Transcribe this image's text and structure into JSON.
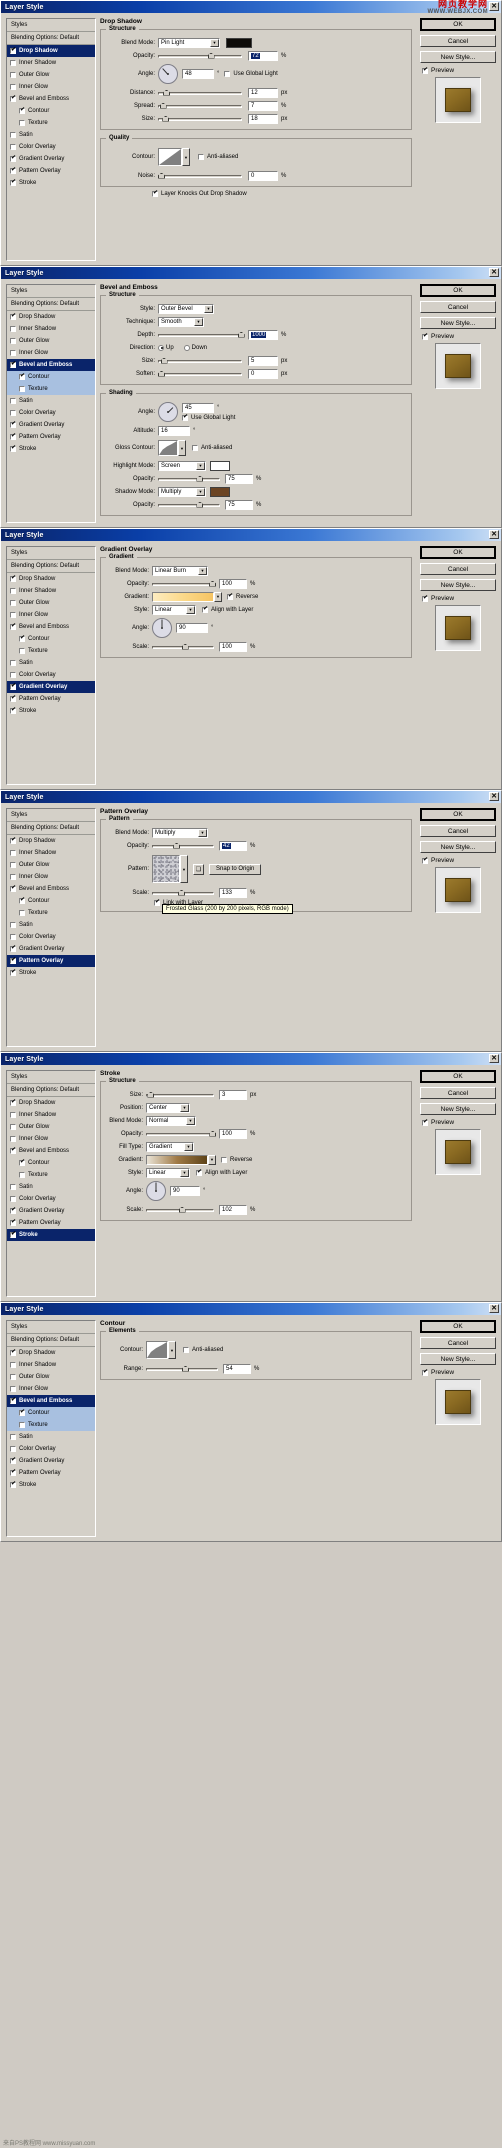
{
  "watermark": {
    "line1": "网页教学网",
    "line2": "WWW.WEBJX.COM"
  },
  "footer_credit": "来自PS教程网 www.missyuan.com",
  "common": {
    "title": "Layer Style",
    "close_label": "✕",
    "styles_header": "Styles",
    "blending_options": "Blending Options: Default",
    "buttons": {
      "ok": "OK",
      "cancel": "Cancel",
      "new_style": "New Style...",
      "preview": "Preview"
    },
    "style_items": [
      {
        "label": "Drop Shadow",
        "checked": true
      },
      {
        "label": "Inner Shadow",
        "checked": false
      },
      {
        "label": "Outer Glow",
        "checked": false
      },
      {
        "label": "Inner Glow",
        "checked": false
      },
      {
        "label": "Bevel and Emboss",
        "checked": true
      },
      {
        "label": "Contour",
        "checked": true,
        "sub": true
      },
      {
        "label": "Texture",
        "checked": false,
        "sub": true
      },
      {
        "label": "Satin",
        "checked": false
      },
      {
        "label": "Color Overlay",
        "checked": false
      },
      {
        "label": "Gradient Overlay",
        "checked": true
      },
      {
        "label": "Pattern Overlay",
        "checked": true
      },
      {
        "label": "Stroke",
        "checked": true
      }
    ],
    "labels": {
      "blend_mode": "Blend Mode:",
      "opacity": "Opacity:",
      "angle": "Angle:",
      "distance": "Distance:",
      "spread": "Spread:",
      "size": "Size:",
      "contour": "Contour:",
      "noise": "Noise:",
      "anti_aliased": "Anti-aliased",
      "use_global_light": "Use Global Light",
      "layer_knocks_out": "Layer Knocks Out Drop Shadow",
      "style": "Style:",
      "technique": "Technique:",
      "depth": "Depth:",
      "direction": "Direction:",
      "soften": "Soften:",
      "altitude": "Altitude:",
      "gloss_contour": "Gloss Contour:",
      "highlight_mode": "Highlight Mode:",
      "shadow_mode": "Shadow Mode:",
      "gradient": "Gradient:",
      "reverse": "Reverse",
      "align_with_layer": "Align with Layer",
      "scale": "Scale:",
      "pattern": "Pattern:",
      "snap_to_origin": "Snap to Origin",
      "link_with_layer": "Link with Layer",
      "position": "Position:",
      "fill_type": "Fill Type:",
      "range": "Range:",
      "elements": "Elements",
      "up": "Up",
      "down": "Down",
      "pct": "%",
      "px": "px",
      "deg": "°"
    }
  },
  "dialogs": [
    {
      "id": "drop-shadow",
      "selected": "Drop Shadow",
      "panel_title": "Drop Shadow",
      "group1": "Structure",
      "group2": "Quality",
      "blend_mode": "Pin Light",
      "blend_color": "#0d0b08",
      "opacity": "72",
      "angle": "48",
      "use_global_light": false,
      "distance": "12",
      "spread": "7",
      "size": "18",
      "anti_aliased": false,
      "noise": "0",
      "knocks_out": true
    },
    {
      "id": "bevel-emboss",
      "selected": "Bevel and Emboss",
      "panel_title": "Bevel and Emboss",
      "group1": "Structure",
      "group2": "Shading",
      "style": "Outer Bevel",
      "technique": "Smooth",
      "depth": "1000",
      "direction": "Up",
      "size": "5",
      "soften": "0",
      "angle": "45",
      "use_global_light": true,
      "altitude": "16",
      "anti_aliased": false,
      "highlight_mode": "Screen",
      "highlight_color": "#ffffff",
      "highlight_opacity": "75",
      "shadow_mode": "Multiply",
      "shadow_color": "#6b4423",
      "shadow_opacity": "75"
    },
    {
      "id": "gradient-overlay",
      "selected": "Gradient Overlay",
      "panel_title": "Gradient Overlay",
      "group1": "Gradient",
      "blend_mode": "Linear Burn",
      "opacity": "100",
      "reverse": true,
      "style": "Linear",
      "align_with_layer": true,
      "angle": "90",
      "scale": "100"
    },
    {
      "id": "pattern-overlay",
      "selected": "Pattern Overlay",
      "panel_title": "Pattern Overlay",
      "group1": "Pattern",
      "blend_mode": "Multiply",
      "opacity": "42",
      "tooltip": "Frosted Glass (200 by 200 pixels, RGB mode)",
      "scale": "133",
      "link_with_layer": true
    },
    {
      "id": "stroke",
      "selected": "Stroke",
      "panel_title": "Stroke",
      "group1": "Structure",
      "size": "3",
      "position": "Center",
      "blend_mode": "Normal",
      "opacity": "100",
      "fill_type": "Gradient",
      "reverse": false,
      "style": "Linear",
      "align_with_layer": true,
      "angle": "90",
      "scale": "102"
    },
    {
      "id": "contour",
      "selected": "Contour",
      "panel_title": "Contour",
      "group1": "Elements",
      "anti_aliased": false,
      "range": "54"
    }
  ]
}
